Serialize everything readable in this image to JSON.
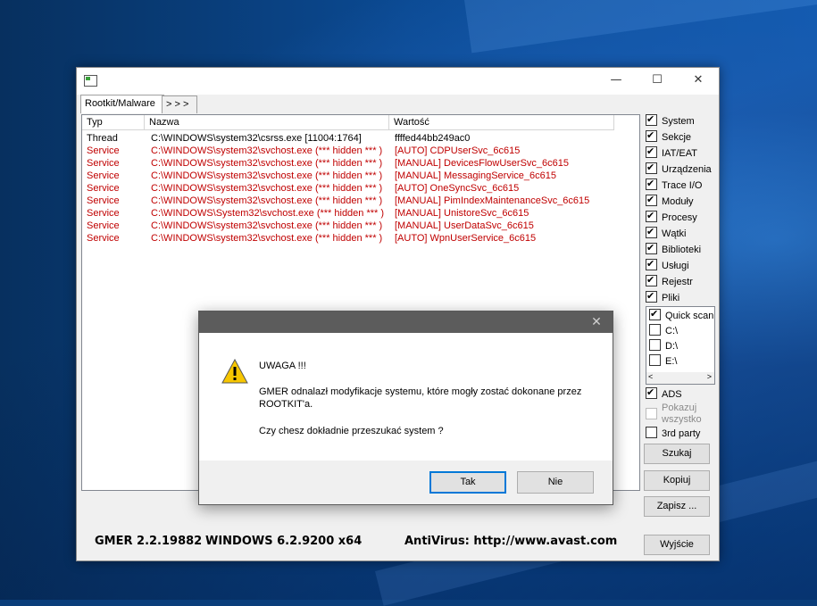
{
  "window": {
    "tabs": [
      "Rootkit/Malware",
      "> > >"
    ],
    "controls": {
      "minimize": "—",
      "maximize": "☐",
      "close": "✕"
    }
  },
  "table": {
    "columns": [
      "Typ",
      "Nazwa",
      "Wartość"
    ],
    "rows": [
      {
        "type": "Thread",
        "name": "C:\\WINDOWS\\system32\\csrss.exe [11004:1764]",
        "value": "ffffed44bb249ac0",
        "color": "#000000"
      },
      {
        "type": "Service",
        "name": "C:\\WINDOWS\\system32\\svchost.exe (*** hidden *** )",
        "value": "[AUTO] CDPUserSvc_6c615",
        "color": "#c00000"
      },
      {
        "type": "Service",
        "name": "C:\\WINDOWS\\system32\\svchost.exe (*** hidden *** )",
        "value": "[MANUAL] DevicesFlowUserSvc_6c615",
        "color": "#c00000"
      },
      {
        "type": "Service",
        "name": "C:\\WINDOWS\\system32\\svchost.exe (*** hidden *** )",
        "value": "[MANUAL] MessagingService_6c615",
        "color": "#c00000"
      },
      {
        "type": "Service",
        "name": "C:\\WINDOWS\\system32\\svchost.exe (*** hidden *** )",
        "value": "[AUTO] OneSyncSvc_6c615",
        "color": "#c00000"
      },
      {
        "type": "Service",
        "name": "C:\\WINDOWS\\system32\\svchost.exe (*** hidden *** )",
        "value": "[MANUAL] PimIndexMaintenanceSvc_6c615",
        "color": "#c00000"
      },
      {
        "type": "Service",
        "name": "C:\\WINDOWS\\System32\\svchost.exe (*** hidden *** )",
        "value": "[MANUAL] UnistoreSvc_6c615",
        "color": "#c00000"
      },
      {
        "type": "Service",
        "name": "C:\\WINDOWS\\system32\\svchost.exe (*** hidden *** )",
        "value": "[MANUAL] UserDataSvc_6c615",
        "color": "#c00000"
      },
      {
        "type": "Service",
        "name": "C:\\WINDOWS\\system32\\svchost.exe (*** hidden *** )",
        "value": "[AUTO] WpnUserService_6c615",
        "color": "#c00000"
      }
    ]
  },
  "options": [
    {
      "label": "System",
      "checked": true
    },
    {
      "label": "Sekcje",
      "checked": true
    },
    {
      "label": "IAT/EAT",
      "checked": true
    },
    {
      "label": "Urządzenia",
      "checked": true
    },
    {
      "label": "Trace I/O",
      "checked": true
    },
    {
      "label": "Moduły",
      "checked": true
    },
    {
      "label": "Procesy",
      "checked": true
    },
    {
      "label": "Wątki",
      "checked": true
    },
    {
      "label": "Biblioteki",
      "checked": true
    },
    {
      "label": "Usługi",
      "checked": true
    },
    {
      "label": "Rejestr",
      "checked": true
    },
    {
      "label": "Pliki",
      "checked": true
    }
  ],
  "drives": [
    {
      "label": "Quick scan",
      "checked": true
    },
    {
      "label": "C:\\",
      "checked": false
    },
    {
      "label": "D:\\",
      "checked": false
    },
    {
      "label": "E:\\",
      "checked": false
    }
  ],
  "extra_options": {
    "ads": {
      "label": "ADS",
      "checked": true
    },
    "show_all": {
      "label": "Pokazuj wszystko",
      "checked": false,
      "disabled": true
    },
    "third_party": {
      "label": "3rd party",
      "checked": false
    }
  },
  "buttons": {
    "scan": "Szukaj",
    "copy": "Kopiuj",
    "save": "Zapisz ...",
    "exit": "Wyjście"
  },
  "status": {
    "version": "GMER 2.2.19882",
    "os": "WINDOWS 6.2.9200  x64",
    "antivirus": "AntiVirus: http://www.avast.com"
  },
  "dialog": {
    "title": "",
    "heading": "UWAGA !!!",
    "message": "GMER odnalazł modyfikacje systemu, które mogły zostać dokonane przez ROOTKIT'a.",
    "question": "Czy chesz dokładnie przeszukać system ?",
    "yes": "Tak",
    "no": "Nie",
    "close": "✕"
  }
}
